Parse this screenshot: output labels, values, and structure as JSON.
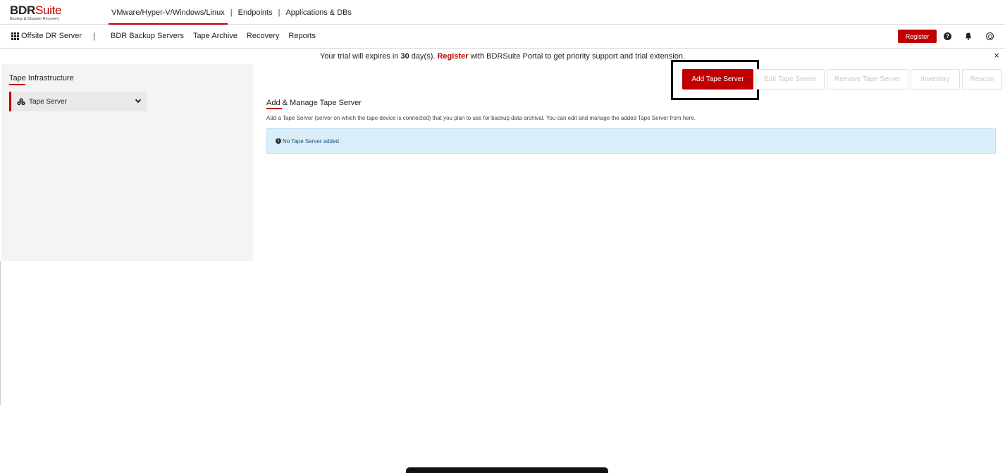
{
  "header": {
    "logo_main": "BDR",
    "logo_suite": "Suite",
    "logo_sub": "Backup & Disaster Recovery",
    "tabs": [
      {
        "label": "VMware/Hyper-V/Windows/Linux"
      },
      {
        "label": "Endpoints"
      },
      {
        "label": "Applications & DBs"
      }
    ],
    "separator": "|"
  },
  "nav": {
    "server": "Offsite DR Server",
    "pipe": "|",
    "items": [
      "BDR Backup Servers",
      "Tape Archive",
      "Recovery",
      "Reports"
    ],
    "register_label": "Register",
    "help_glyph": "?"
  },
  "trial": {
    "prefix": "Your trial will expires in ",
    "days": "30",
    "mid": " day(s). ",
    "register": "Register",
    "suffix": " with BDRSuite Portal to get priority support and trial extension.",
    "close": "×"
  },
  "sidebar": {
    "title": "Tape Infrastructure",
    "item": "Tape Server"
  },
  "toolbar": {
    "add": "Add Tape Server",
    "edit": "Edit Tape Server",
    "remove": "Remove Tape Server",
    "inventory": "Inventory",
    "rescan": "Rescan"
  },
  "main": {
    "title": "Add & Manage Tape Server",
    "description": "Add a Tape Server (server on which the tape device is connected) that you plan to use for backup data archival. You can edit and manage the added Tape Server from here.",
    "info": "No Tape Server added",
    "info_glyph": "i"
  },
  "colors": {
    "accent": "#c00000",
    "info_bg": "#d9eef8"
  }
}
